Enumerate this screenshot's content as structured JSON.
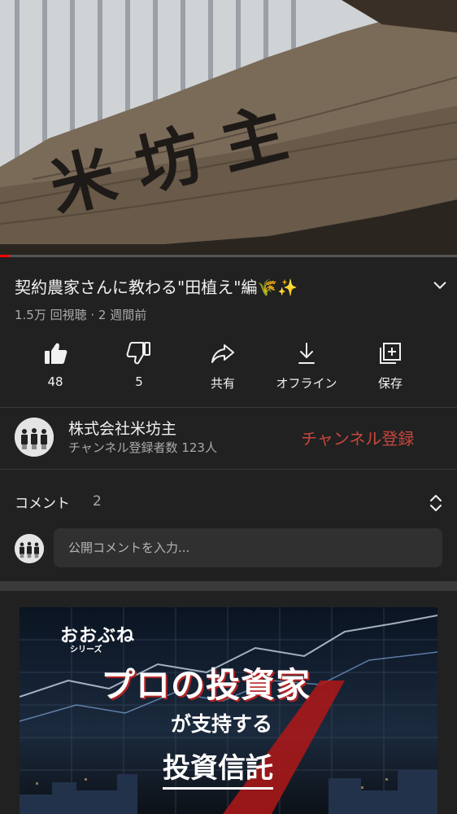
{
  "player": {
    "progress": 0.02,
    "thumbnail_sign_text": "米坊主",
    "colors": {
      "progress": "#ff0000"
    }
  },
  "video": {
    "title": "契約農家さんに教わる\"田植え\"編🌾✨",
    "meta": "1.5万 回視聴 · 2 週間前"
  },
  "actions": [
    {
      "icon": "thumbs-up-icon",
      "label": "48"
    },
    {
      "icon": "thumbs-down-icon",
      "label": "5"
    },
    {
      "icon": "share-icon",
      "label": "共有"
    },
    {
      "icon": "download-icon",
      "label": "オフライン"
    },
    {
      "icon": "save-playlist-icon",
      "label": "保存"
    }
  ],
  "channel": {
    "name": "株式会社米坊主",
    "subscribers": "チャンネル登録者数 123人",
    "subscribe_label": "チャンネル登録",
    "colors": {
      "subscribe": "#c8473c"
    }
  },
  "comments": {
    "title": "コメント",
    "count": "2",
    "placeholder": "公開コメントを入力..."
  },
  "ad": {
    "brand": "おおぶね",
    "series": "シリーズ",
    "headline": "プロの投資家",
    "subline": "が支持する",
    "main": "投資信託"
  }
}
